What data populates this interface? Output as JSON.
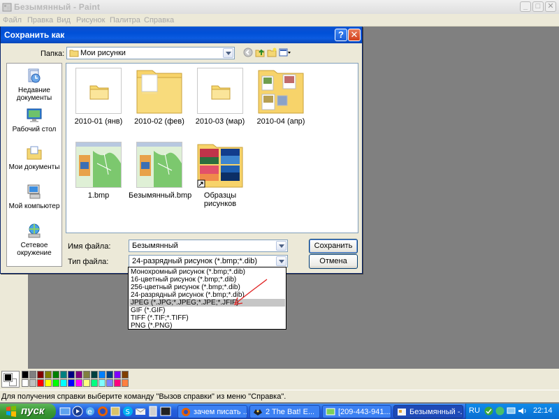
{
  "paint": {
    "title": "Безымянный - Paint",
    "menu": [
      "Файл",
      "Правка",
      "Вид",
      "Рисунок",
      "Палитра",
      "Справка"
    ],
    "status": "Для получения справки выберите команду \"Вызов справки\" из меню \"Справка\".",
    "palette": [
      "#000000",
      "#808080",
      "#800000",
      "#808000",
      "#008000",
      "#008080",
      "#000080",
      "#800080",
      "#808040",
      "#004040",
      "#0080ff",
      "#004080",
      "#8000ff",
      "#804000",
      "#ffffff",
      "#c0c0c0",
      "#ff0000",
      "#ffff00",
      "#00ff00",
      "#00ffff",
      "#0000ff",
      "#ff00ff",
      "#ffff80",
      "#00ff80",
      "#80ffff",
      "#8080ff",
      "#ff0080",
      "#ff8040"
    ]
  },
  "dialog": {
    "title": "Сохранить как",
    "folder_label": "Папка:",
    "folder_value": "Мои рисунки",
    "places": [
      {
        "label": "Недавние документы",
        "icon": "recent-documents-icon"
      },
      {
        "label": "Рабочий стол",
        "icon": "desktop-icon"
      },
      {
        "label": "Мои документы",
        "icon": "my-documents-icon"
      },
      {
        "label": "Мой компьютер",
        "icon": "my-computer-icon"
      },
      {
        "label": "Сетевое окружение",
        "icon": "network-icon"
      }
    ],
    "files": [
      {
        "label": "2010-01 (янв)",
        "icon": "folder-icon"
      },
      {
        "label": "2010-02 (фев)",
        "icon": "folder-icon"
      },
      {
        "label": "2010-03 (мар)",
        "icon": "folder-icon"
      },
      {
        "label": "2010-04 (апр)",
        "icon": "folder-icon"
      },
      {
        "label": "1.bmp",
        "icon": "bmp-thumbnail"
      },
      {
        "label": "Безымянный.bmp",
        "icon": "bmp-thumbnail"
      },
      {
        "label": "Образцы рисунков",
        "icon": "folder-shortcut-icon"
      }
    ],
    "filename_label": "Имя файла:",
    "filename_value": "Безымянный",
    "filetype_label": "Тип файла:",
    "filetype_value": "24-разрядный рисунок (*.bmp;*.dib)",
    "save_label": "Сохранить",
    "cancel_label": "Отмена",
    "filetype_options": [
      "Монохромный рисунок (*.bmp;*.dib)",
      "16-цветный рисунок (*.bmp;*.dib)",
      "256-цветный рисунок (*.bmp;*.dib)",
      "24-разрядный рисунок (*.bmp;*.dib)",
      "JPEG (*.JPG;*.JPEG;*.JPE;*.JFIF)",
      "GIF (*.GIF)",
      "TIFF (*.TIF;*.TIFF)",
      "PNG (*.PNG)"
    ],
    "selected_option": "JPEG (*.JPG;*.JPEG;*.JPE;*.JFIF)"
  },
  "taskbar": {
    "start_label": "пуск",
    "tasks": [
      {
        "label": "зачем писать ...",
        "active": false
      },
      {
        "label": "2 The Bat! E...",
        "active": false
      },
      {
        "label": "[209-443-941...",
        "active": false
      },
      {
        "label": "Безымянный -...",
        "active": true
      }
    ],
    "language": "RU",
    "clock": "22:14"
  }
}
